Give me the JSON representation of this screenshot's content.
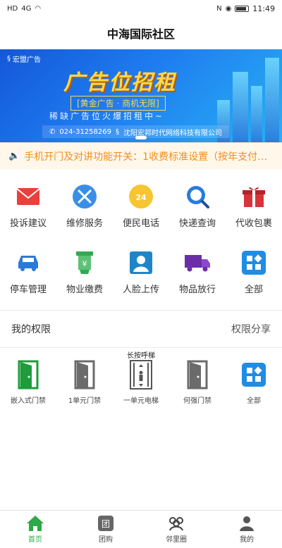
{
  "status": {
    "network": "HD",
    "signal": "4G",
    "time": "11:49"
  },
  "header": {
    "title": "中海国际社区"
  },
  "banner": {
    "brand": "宏盟广告",
    "headline": "广告位招租",
    "tagline": "[黄金广告 · 商机无限]",
    "subline": "稀缺广告位火爆招租中~",
    "phone": "024-31258269",
    "company": "沈阳宏邦时代网络科技有限公司"
  },
  "notice": {
    "text": "手机开门及对讲功能开关：1收费标准设置（按年支付…"
  },
  "services": [
    {
      "label": "投诉建议",
      "icon": "mail-icon"
    },
    {
      "label": "维修服务",
      "icon": "wrench-icon"
    },
    {
      "label": "便民电话",
      "icon": "phone-24-icon"
    },
    {
      "label": "快递查询",
      "icon": "package-search-icon"
    },
    {
      "label": "代收包裹",
      "icon": "gift-icon"
    },
    {
      "label": "停车管理",
      "icon": "car-icon"
    },
    {
      "label": "物业缴费",
      "icon": "payment-icon"
    },
    {
      "label": "人脸上传",
      "icon": "face-icon"
    },
    {
      "label": "物品放行",
      "icon": "truck-icon"
    },
    {
      "label": "全部",
      "icon": "all-apps-icon"
    }
  ],
  "permissions": {
    "title": "我的权限",
    "share": "权限分享",
    "items": [
      {
        "label": "嵌入式门禁",
        "hint": ""
      },
      {
        "label": "1单元门禁",
        "hint": ""
      },
      {
        "label": "一单元电梯",
        "hint": "长按呼梯"
      },
      {
        "label": "何强门禁",
        "hint": ""
      },
      {
        "label": "全部",
        "hint": ""
      }
    ]
  },
  "tabs": [
    {
      "label": "首页",
      "icon": "home-icon",
      "active": true
    },
    {
      "label": "团购",
      "icon": "group-buy-icon",
      "active": false
    },
    {
      "label": "邻里圈",
      "icon": "neighbors-icon",
      "active": false
    },
    {
      "label": "我的",
      "icon": "profile-icon",
      "active": false
    }
  ],
  "colors": {
    "accent": "#2ea84a",
    "notice": "#f08f1a",
    "banner": "#1f7cf0"
  }
}
